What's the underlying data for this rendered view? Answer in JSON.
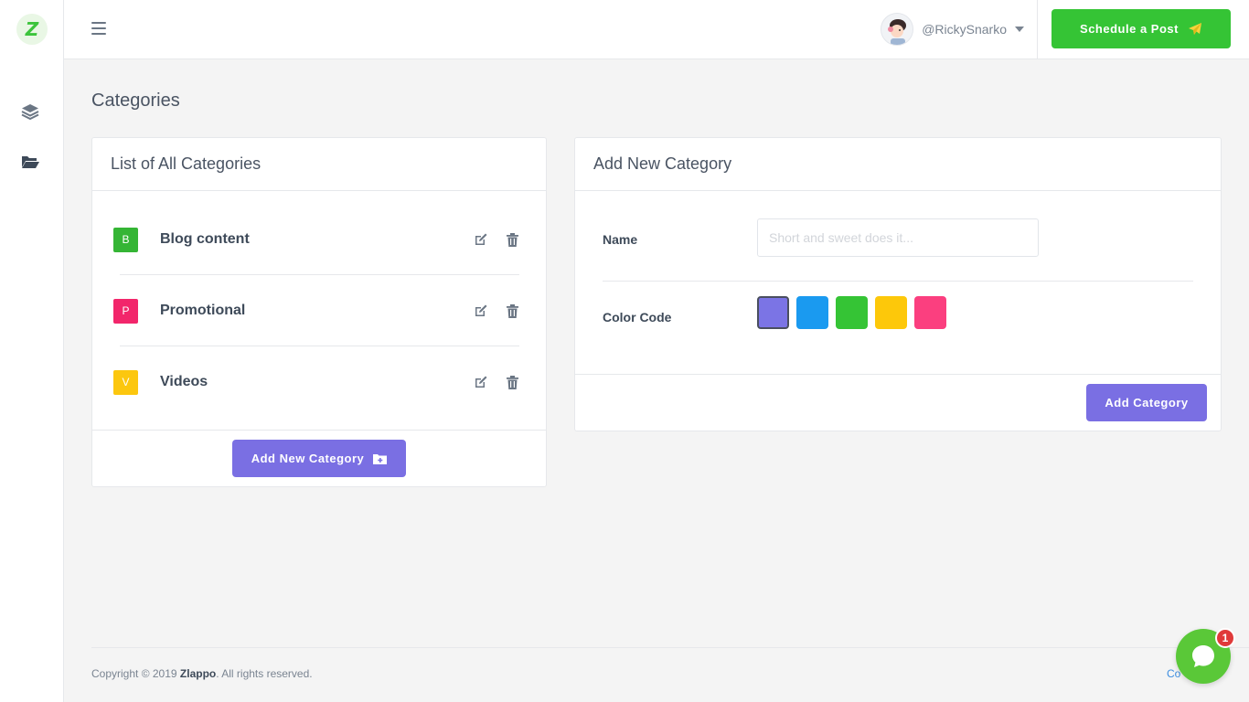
{
  "sidebar": {
    "logo_letter": "Z",
    "icons": [
      "layers-icon",
      "folder-open-icon"
    ]
  },
  "topbar": {
    "username": "@RickySnarko",
    "schedule_label": "Schedule a Post"
  },
  "page": {
    "title": "Categories"
  },
  "categories_card": {
    "title": "List of All Categories",
    "items": [
      {
        "initial": "B",
        "name": "Blog content",
        "color": "#35b535"
      },
      {
        "initial": "P",
        "name": "Promotional",
        "color": "#f2266b"
      },
      {
        "initial": "V",
        "name": "Videos",
        "color": "#fcc70f"
      }
    ],
    "add_button_label": "Add New Category"
  },
  "add_card": {
    "title": "Add New Category",
    "name_label": "Name",
    "name_placeholder": "Short and sweet does it...",
    "name_value": "",
    "color_label": "Color Code",
    "colors": [
      "#7b74e5",
      "#1a9af0",
      "#35c435",
      "#fdc80a",
      "#fb3f7f"
    ],
    "selected_color": "#7b74e5",
    "submit_label": "Add Category"
  },
  "footer": {
    "copyright_prefix": "Copyright © 2019 ",
    "brand": "Zlappo",
    "copyright_suffix": ". All rights reserved.",
    "link_text": "Co"
  },
  "chat": {
    "badge_count": "1"
  },
  "colors": {
    "accent_purple": "#7a6fe3",
    "accent_green": "#35c435"
  }
}
